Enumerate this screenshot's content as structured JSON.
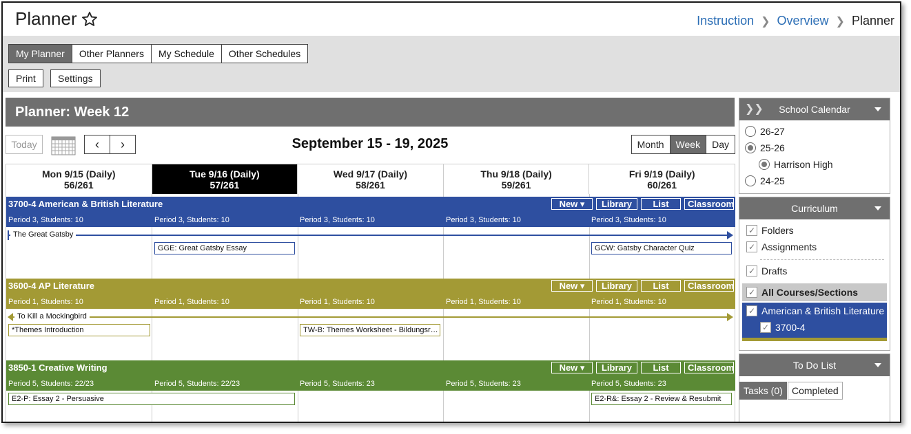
{
  "header": {
    "title": "Planner",
    "breadcrumb": [
      "Instruction",
      "Overview",
      "Planner"
    ]
  },
  "tabs": [
    {
      "label": "My Planner",
      "active": true
    },
    {
      "label": "Other Planners",
      "active": false
    },
    {
      "label": "My Schedule",
      "active": false
    },
    {
      "label": "Other Schedules",
      "active": false
    }
  ],
  "actions": {
    "print": "Print",
    "settings": "Settings"
  },
  "planner": {
    "title": "Planner: Week 12",
    "today": "Today",
    "date_range": "September 15 - 19, 2025",
    "prev": "‹",
    "next": "›",
    "views": [
      {
        "label": "Month",
        "active": false
      },
      {
        "label": "Week",
        "active": true
      },
      {
        "label": "Day",
        "active": false
      }
    ],
    "days": [
      {
        "label": "Mon 9/15 (Daily)",
        "count": "56/261",
        "selected": false
      },
      {
        "label": "Tue 9/16 (Daily)",
        "count": "57/261",
        "selected": true
      },
      {
        "label": "Wed 9/17 (Daily)",
        "count": "58/261",
        "selected": false
      },
      {
        "label": "Thu 9/18 (Daily)",
        "count": "59/261",
        "selected": false
      },
      {
        "label": "Fri 9/19 (Daily)",
        "count": "60/261",
        "selected": false
      }
    ],
    "course_buttons": {
      "new": "New ▾",
      "library": "Library",
      "list": "List",
      "classroom": "Classroom"
    },
    "courses": [
      {
        "title": "3700-4 American & British Literature",
        "color": "#2e4fa0",
        "periods": [
          "Period 3, Students: 10",
          "Period 3, Students: 10",
          "Period 3, Students: 10",
          "Period 3, Students: 10",
          "Period 3, Students: 10"
        ],
        "unit": "The Great Gatsby",
        "items": [
          {
            "label": "GGE: Great Gatsby Essay"
          },
          {
            "label": "GCW: Gatsby Character Quiz"
          }
        ]
      },
      {
        "title": "3600-4 AP Literature",
        "color": "#a39a35",
        "periods": [
          "Period 1, Students: 10",
          "Period 1, Students: 10",
          "Period 1, Students: 10",
          "Period 1, Students: 10",
          "Period 1, Students: 10"
        ],
        "unit": "To Kill a Mockingbird",
        "items": [
          {
            "label": "*Themes Introduction"
          },
          {
            "label": "TW-B: Themes Worksheet - Bildungsroman"
          }
        ]
      },
      {
        "title": "3850-1 Creative Writing",
        "color": "#5b8a35",
        "periods": [
          "Period 5, Students: 22/23",
          "Period 5, Students: 22/23",
          "Period 5, Students: 23",
          "Period 5, Students: 23",
          "Period 5, Students: 23"
        ],
        "items": [
          {
            "label": "E2-P: Essay 2 - Persuasive"
          },
          {
            "label": "E2-R&: Essay 2 - Review & Resubmit"
          }
        ]
      }
    ]
  },
  "sidebar": {
    "school_calendar": {
      "title": "School Calendar",
      "options": [
        {
          "label": "26-27",
          "checked": false
        },
        {
          "label": "25-26",
          "checked": true
        },
        {
          "label": "Harrison High",
          "checked": true
        },
        {
          "label": "24-25",
          "checked": false
        }
      ]
    },
    "curriculum": {
      "title": "Curriculum",
      "folders": "Folders",
      "assignments": "Assignments",
      "drafts": "Drafts",
      "all_courses": "All Courses/Sections",
      "course": "American & British Literature",
      "section": "3700-4"
    },
    "todo": {
      "title": "To Do List",
      "tasks": "Tasks (0)",
      "completed": "Completed"
    }
  },
  "colors": {
    "blue": "#2e4fa0",
    "olive": "#a39a35",
    "green": "#5b8a35",
    "header_gray": "#6f6f6f",
    "link": "#2a6db5"
  }
}
